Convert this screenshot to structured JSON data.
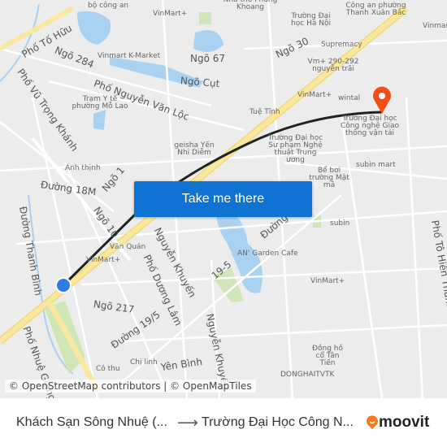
{
  "map": {
    "labels": [
      "Phố Tố Hữu",
      "bộ công an",
      "VinMart+",
      "Nhà thờ Phùng Khoang",
      "Công an phường Thanh Xuân Bắc",
      "Trường Đại học Hà Nội",
      "Ngõ 284",
      "Vinmart",
      "K-Market",
      "Ngõ 67",
      "Ngõ 30",
      "Supremacy",
      "Vm+ 290-292 nguyễn trãi",
      "Ngõ Cụt",
      "Phố Nguyễn Văn Lộc",
      "Phố Vũ Trọng Khánh",
      "Trạm Y tế phường Mỗ Lao",
      "VinMart+",
      "Tuệ Tĩnh",
      "wintal",
      "Trường Đại học Công nghệ Giao thông vận tải",
      "geisha Yến Nhi Diễm",
      "Trường Đại học Sư phạm Nghệ thuật Trung ương",
      "Anh thịnh",
      "Đường 18M",
      "Ngõ 1",
      "subin mart",
      "Bể bơi trường Mật mã",
      "Đường Thanh Bình",
      "Ngõ 10",
      "Văn Quán",
      "VinMart+",
      "Phố Dương Lâm",
      "Nguyễn Khuyến",
      "19-5",
      "AN' Garden Cafe",
      "subin",
      "VinMart+",
      "Ngõ 217",
      "Đường 19/5",
      "Phố Nhuệ Giang",
      "Nguyễn Khuyến",
      "Yên Bình",
      "Chị linh",
      "Cô thu",
      "Đồng hồ cổ Tân Tiến",
      "DONGHAITVTK",
      "Vinmart",
      "Phố Tô Hiến Thành",
      "Đường"
    ],
    "attribution": "© OpenStreetMap contributors | © OpenMapTiles",
    "cta_label": "Take me there",
    "colors": {
      "route": "#222222",
      "origin": "#2f7de1",
      "destination": "#f04e16",
      "button": "#0f73d4",
      "water": "#a9d2f2",
      "park": "#cfe6b8",
      "highway": "#fbe8a0"
    }
  },
  "footer": {
    "from": "Khách Sạn Sông Nhuệ (...",
    "arrow": "⟶",
    "to": "Trường Đại Học Công N...",
    "brand": "moovit"
  }
}
